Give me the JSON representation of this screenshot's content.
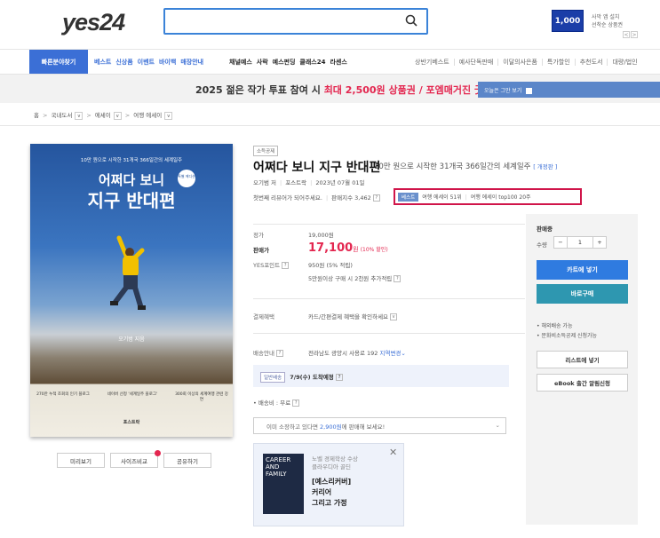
{
  "header": {
    "logo": "yes24",
    "search_placeholder": "",
    "promo_amount": "1,000",
    "promo_text": "사막 앱 설치\n선착순 상품권",
    "promo_prev": "<",
    "promo_next": ">"
  },
  "nav": {
    "quick_button": "빠른분야찾기",
    "blue_items": [
      "베스트",
      "신상품",
      "이벤트",
      "바이백",
      "매장안내"
    ],
    "dark_items": [
      "채널예스",
      "사락",
      "예스펀딩",
      "클래스24",
      "라센스"
    ],
    "right_items": [
      "상반기베스트",
      "예사단독판매",
      "이달의사은품",
      "특가할인",
      "추천도서",
      "대량/법인"
    ]
  },
  "banner": {
    "text_prefix": "2025 젊은 작가 투표 참여 시 ",
    "text_highlight": "최대 2,500원 상품권 / 포엠매거진 굿즈",
    "hide_today": "오늘은 그만 보기"
  },
  "breadcrumb": [
    "홈",
    "국내도서",
    "에세이",
    "여행 에세이"
  ],
  "cover": {
    "subtitle": "10만 원으로 시작한 31개국 366일간의 세계일주",
    "title_line1": "어쩌다 보니",
    "title_line2": "지구 반대편",
    "badge": "특별 에디션",
    "author": "오기범 지음",
    "awards": [
      "270만 누적 조회의 인기 블로그",
      "네이버 선정 '세계일주 블로그'",
      "300회 이상의 세계여행 관련 강연"
    ],
    "publisher": "포스트락"
  },
  "cover_buttons": [
    "미리보기",
    "사이즈비교",
    "공유하기"
  ],
  "product": {
    "tag": "소득공제",
    "title": "어쩌다 보니 지구 반대편",
    "subtitle": "10만 원으로 시작한 31개국 366일간의 세계일주",
    "revision": "[ 개정판 ]",
    "author": "오기범 저",
    "publisher": "포스트락",
    "date": "2023년 07월 01일",
    "review_prompt": "첫번째 리뷰어가 되어주세요.",
    "sales_index": "판매지수 3,462",
    "rank_badge": "베스트",
    "rank1": "여행 에세이 51위",
    "rank2": "여행 에세이 top100 20주"
  },
  "price": {
    "list_label": "정가",
    "list_price": "19,000원",
    "sale_label": "판매가",
    "sale_price": "17,100",
    "won": "원",
    "discount": "(10% 할인)",
    "points_label": "YES포인트",
    "points": "950원 (5% 적립)",
    "points_extra": "5만원이상 구매 시 2천원 추가적립"
  },
  "payment": {
    "label": "결제혜택",
    "value": "카드/간편결제 혜택을 확인하세요"
  },
  "shipping": {
    "label": "배송안내",
    "address": "전라남도 광양시 사용로 192",
    "change": "지역변경",
    "type": "일반배송",
    "eta": "7/9(수) 도착예정",
    "fee": "배송비 : 무료"
  },
  "resell": {
    "prefix": "이미 소장하고 있다면 ",
    "amount": "2,900원",
    "suffix": "에 판매해 보세요!"
  },
  "ad": {
    "book_title": "CAREER AND FAMILY",
    "line1": "노벨 경제학상 수상",
    "line2": "클라우디아 골딘",
    "big1": "[예스리커버]",
    "big2": "커리어",
    "big3": "그리고 가정"
  },
  "panel": {
    "status": "판매중",
    "qty_label": "수량",
    "qty_minus": "−",
    "qty_value": "1",
    "qty_plus": "+",
    "cart": "카트에 넣기",
    "buy": "바로구매",
    "note1": "• 해외배송 가능",
    "note2": "• 문화비소득공제 신청가능",
    "list_btn": "리스트에 넣기",
    "ebook_btn": "eBook 출간 알림신청"
  }
}
